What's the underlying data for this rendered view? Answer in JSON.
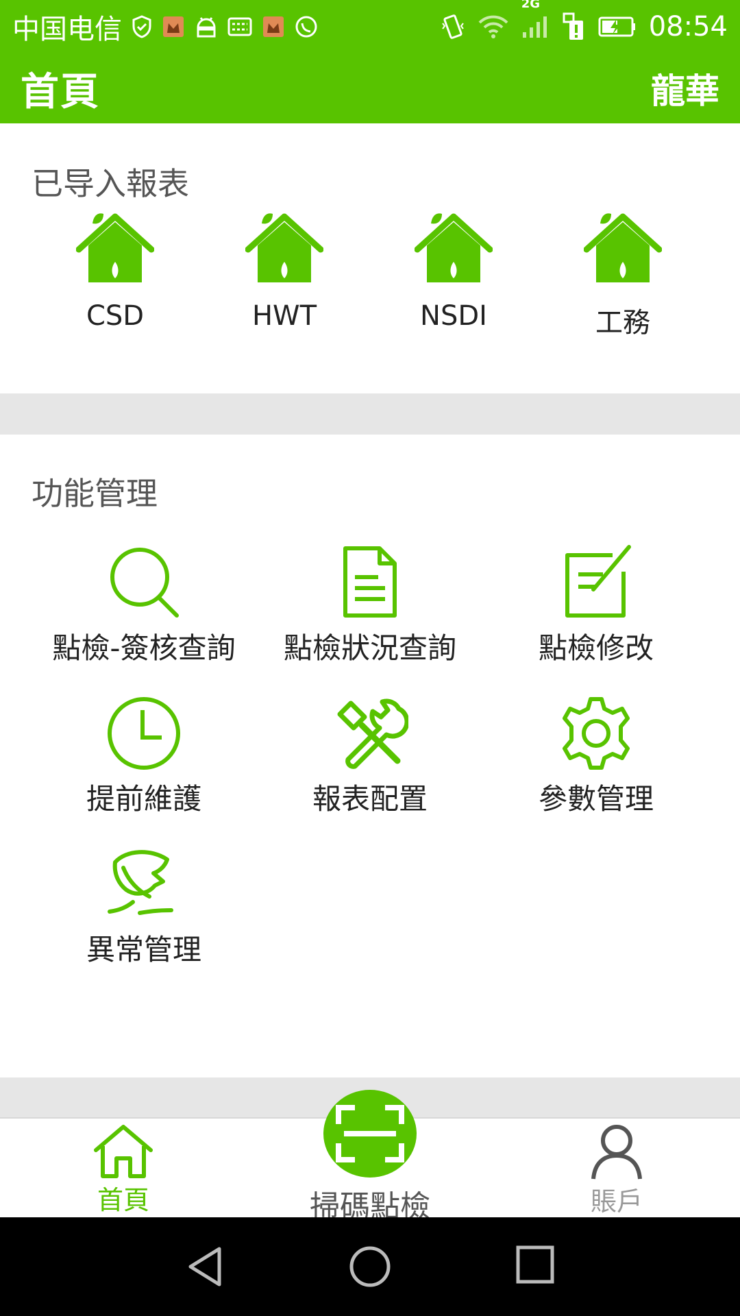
{
  "status_bar": {
    "carrier": "中国电信",
    "network_type": "2G",
    "time": "08:54",
    "icons": [
      "shield-icon",
      "app-notification-icon",
      "android-icon",
      "keyboard-icon",
      "app-notification-icon",
      "whatsapp-icon",
      "vibrate-icon",
      "wifi-icon",
      "signal-icon",
      "sim-icon",
      "battery-icon"
    ]
  },
  "app_bar": {
    "title": "首頁",
    "user": "龍華"
  },
  "imported_reports": {
    "title": "已导入報表",
    "items": [
      {
        "label": "CSD",
        "icon": "house-leaf-icon"
      },
      {
        "label": "HWT",
        "icon": "house-leaf-icon"
      },
      {
        "label": "NSDI",
        "icon": "house-leaf-icon"
      },
      {
        "label": "工務",
        "icon": "house-leaf-icon"
      }
    ]
  },
  "function_management": {
    "title": "功能管理",
    "items": [
      {
        "label": "點檢-簽核查詢",
        "icon": "search-icon"
      },
      {
        "label": "點檢狀況查詢",
        "icon": "document-icon"
      },
      {
        "label": "點檢修改",
        "icon": "edit-icon"
      },
      {
        "label": "提前維護",
        "icon": "clock-icon"
      },
      {
        "label": "報表配置",
        "icon": "tools-icon"
      },
      {
        "label": "參數管理",
        "icon": "gear-icon"
      },
      {
        "label": "異常管理",
        "icon": "leaf-icon"
      }
    ]
  },
  "bottom_nav": {
    "home": "首頁",
    "scan": "掃碼點檢",
    "account": "賬戶",
    "active": "home"
  },
  "colors": {
    "brand": "#58c300",
    "active_nav": "#58c300",
    "inactive_nav": "#999999"
  }
}
